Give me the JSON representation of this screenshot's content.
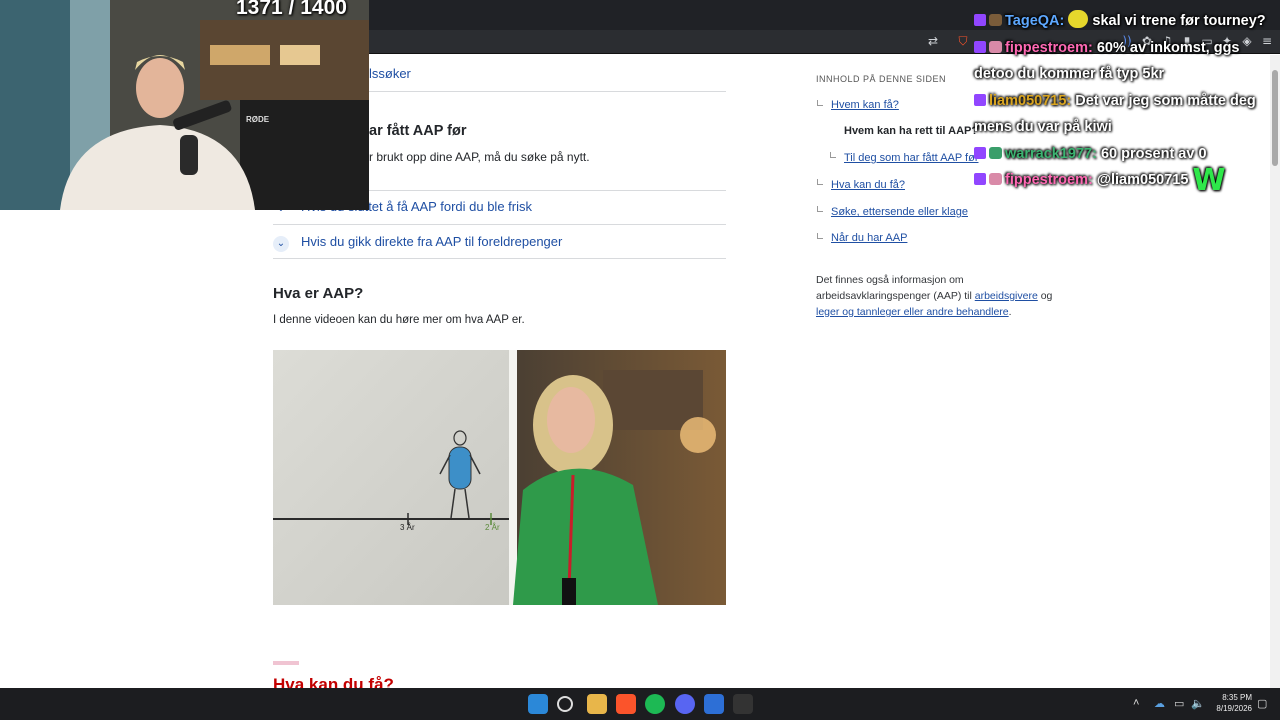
{
  "page": {
    "accordion_partial": "lssøker",
    "section_heading_partial": "ar fått AAP før",
    "section_text_partial": "r brukt opp dine AAP, må du søke på nytt.",
    "accordion_items": [
      "Hvis du sluttet å få AAP fordi du ble frisk",
      "Hvis du gikk direkte fra AAP til foreldrepenger"
    ],
    "hva_er_heading": "Hva er AAP?",
    "hva_er_text": "I denne videoen kan du høre mer om hva AAP er.",
    "next_heading": "Hva kan du få?"
  },
  "toc": {
    "heading": "INNHOLD PÅ DENNE SIDEN",
    "items": [
      "Hvem kan få?",
      "Hvem kan ha rett til AAP?",
      "Til deg som har fått AAP før",
      "Hva kan du få?",
      "Søke, ettersende eller klage",
      "Når du har AAP"
    ],
    "info_prefix": "Det finnes også informasjon om arbeidsavklaringspenger (AAP) til",
    "info_link1": "arbeidsgivere",
    "info_mid": "og",
    "info_link2": "leger og tannleger eller andre behandlere",
    "info_suffix": "."
  },
  "video": {
    "tick1": "3 År",
    "tick2": "2 År"
  },
  "webcam": {
    "counter": "1371 / 1400",
    "mic_label": "RØDE"
  },
  "chat": [
    {
      "user": "TageQA:",
      "user_color": "#5ea8ff",
      "text": "skal vi trene før tourney?"
    },
    {
      "user": "fippestroem:",
      "user_color": "#ff69b4",
      "text": "60% av inkomst, ggs detoo du kommer få typ 5kr"
    },
    {
      "user": "liam050715:",
      "user_color": "#daa520",
      "text": "Det var jeg som måtte deg mens du var på kiwi"
    },
    {
      "user": "warrack1977:",
      "user_color": "#3cb371",
      "text": "60 prosent av 0"
    },
    {
      "user": "fippestroem:",
      "user_color": "#ff69b4",
      "text": "@liam050715"
    }
  ],
  "chat_emote": "W",
  "clock": {
    "time": "8:35 PM",
    "date": "8/19/2026"
  },
  "taskbar_icons": [
    "windows-start",
    "search",
    "file-explorer",
    "brave",
    "spotify",
    "discord",
    "ccleaner",
    "epic-games"
  ]
}
